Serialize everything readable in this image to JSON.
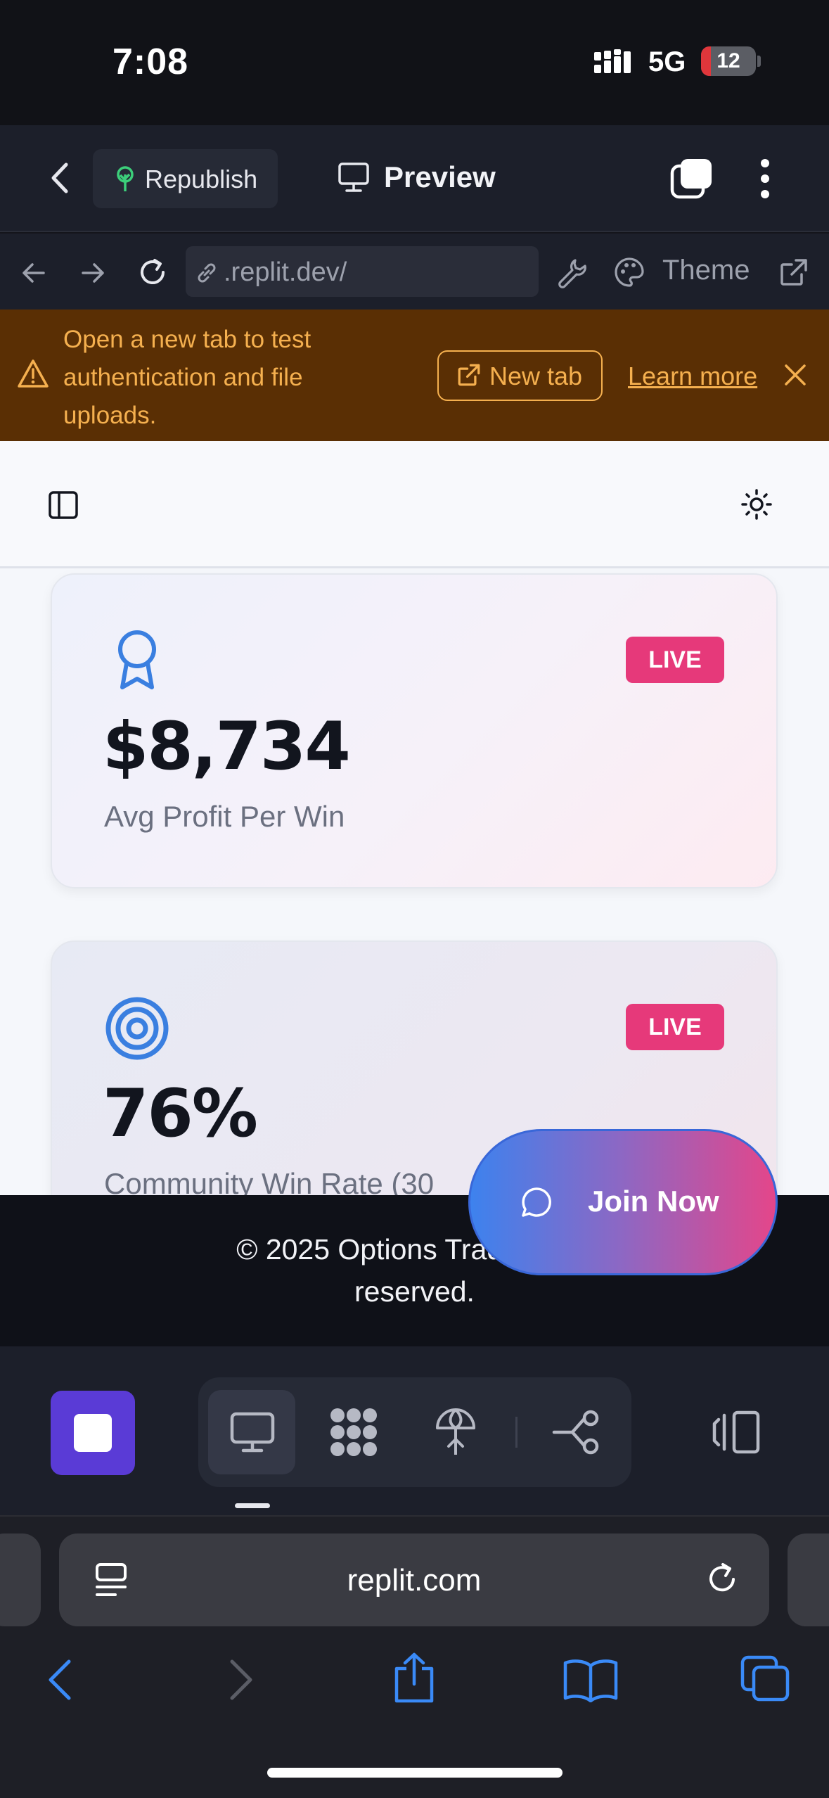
{
  "status_bar": {
    "time": "7:08",
    "network": "5G",
    "battery": "12"
  },
  "replit_header": {
    "republish_label": "Republish",
    "preview_label": "Preview"
  },
  "url_bar": {
    "url": ".replit.dev/",
    "theme_label": "Theme"
  },
  "banner": {
    "message": "Open a new tab to test authentication and file uploads.",
    "new_tab_label": "New tab",
    "learn_more_label": "Learn more"
  },
  "cards": [
    {
      "value": "$8,734",
      "label": "Avg Profit Per Win",
      "badge": "LIVE",
      "icon": "award-ribbon-icon"
    },
    {
      "value": "76%",
      "label": "Community Win Rate (30",
      "badge": "LIVE",
      "icon": "target-icon"
    }
  ],
  "footer": {
    "text": "© 2025 Options Trading Uni… reserved.",
    "line1": "© 2025 Options Trading Uni",
    "line2": "reserved."
  },
  "join_button": {
    "label": "Join Now"
  },
  "safari": {
    "address": "replit.com"
  },
  "colors": {
    "accent_purple": "#5a3bd6",
    "live_badge": "#e6397a",
    "banner_bg": "#5a2f04",
    "banner_text": "#f5b04f",
    "join_start": "#3d82ee",
    "join_end": "#e4468a"
  }
}
